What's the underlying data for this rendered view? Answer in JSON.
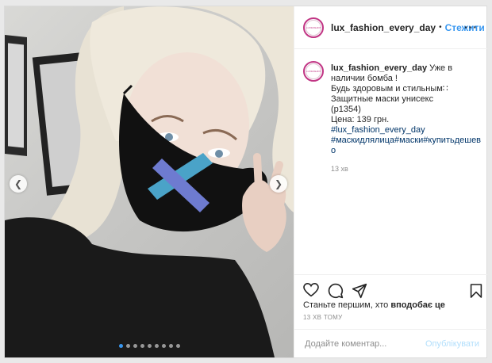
{
  "post": {
    "username": "lux_fashion_every_day",
    "separator": "•",
    "follow_label": "Стежити",
    "more_icon": "more-horizontal-icon",
    "avatar_text": "LUXFASHION EVERYDAY"
  },
  "caption": {
    "username": "lux_fashion_every_day",
    "first_line": "Уже в наличии бомба !",
    "lines": [
      "Будь здоровым и стильным∷",
      "Защитные маски унисекс",
      "(p1354)",
      "Цена: 139 грн."
    ],
    "hashtags": [
      "#lux_fashion_every_day",
      "#маскидлялица#маски#купитьдешево"
    ],
    "time": "13 хв"
  },
  "actions": {
    "like_icon": "heart-icon",
    "comment_icon": "comment-icon",
    "share_icon": "share-icon",
    "save_icon": "bookmark-icon"
  },
  "likes": {
    "prefix": "Станьте першим, хто ",
    "bold": "вподобає це"
  },
  "post_time": "13 ХВ ТОМУ",
  "comment": {
    "placeholder": "Додайте коментар...",
    "publish_label": "Опублікувати"
  },
  "carousel": {
    "total_slides": 9,
    "active_slide": 1
  }
}
